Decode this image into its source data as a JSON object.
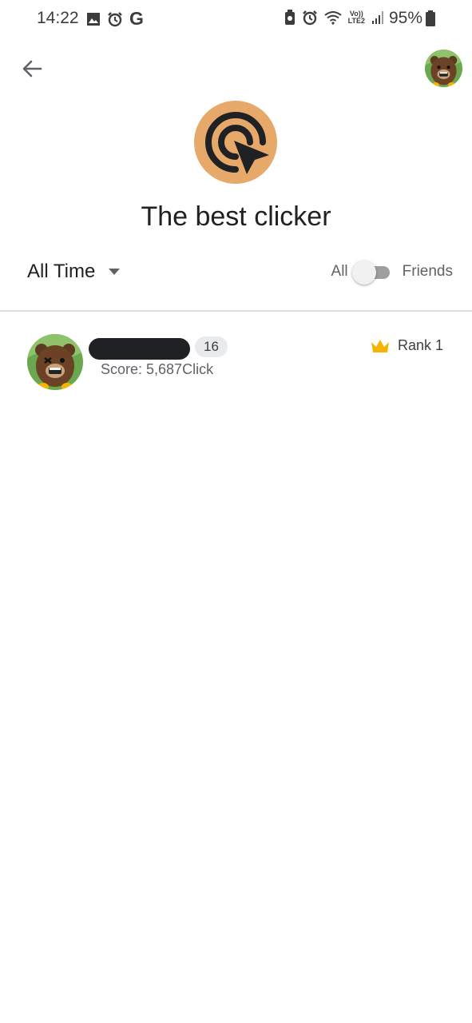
{
  "status_bar": {
    "time": "14:22",
    "battery_percent": "95%",
    "network_label_top": "Vo))",
    "network_label_bottom": "LTE2",
    "left_icons": [
      "image-icon",
      "alarm-icon",
      "google-icon"
    ],
    "right_icons": [
      "battery-saver-icon",
      "alarm-icon",
      "wifi-icon",
      "signal-icon",
      "battery-icon"
    ]
  },
  "header": {
    "back_icon": "arrow-back-icon",
    "avatar_icon": "bear-avatar"
  },
  "leaderboard": {
    "title": "The best clicker",
    "icon": "cursor-click-icon",
    "icon_background": "#e7a969",
    "timeframe": "All Time",
    "filter_all_label": "All",
    "filter_friends_label": "Friends",
    "friends_only": false
  },
  "entries": [
    {
      "level": "16",
      "score": "Score: 5,687Click",
      "rank": "Rank 1",
      "rank_icon": "crown-icon",
      "avatar": "bear-avatar"
    }
  ],
  "colors": {
    "crown": "#f4b400",
    "accent": "#e7a969"
  }
}
